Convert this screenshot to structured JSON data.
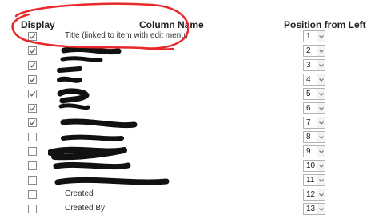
{
  "headers": {
    "display": "Display",
    "column_name": "Column Name",
    "position": "Position from Left"
  },
  "rows": [
    {
      "checked": true,
      "name": "Title (linked to item with edit menu)",
      "position": "1"
    },
    {
      "checked": true,
      "name": "",
      "position": "2"
    },
    {
      "checked": true,
      "name": "",
      "position": "3"
    },
    {
      "checked": true,
      "name": "",
      "position": "4"
    },
    {
      "checked": true,
      "name": "",
      "position": "5"
    },
    {
      "checked": true,
      "name": "",
      "position": "6"
    },
    {
      "checked": true,
      "name": "",
      "position": "7"
    },
    {
      "checked": false,
      "name": "",
      "position": "8"
    },
    {
      "checked": false,
      "name": "",
      "position": "9"
    },
    {
      "checked": false,
      "name": "",
      "position": "10"
    },
    {
      "checked": false,
      "name": "",
      "position": "11"
    },
    {
      "checked": false,
      "name": "Created",
      "position": "12"
    },
    {
      "checked": false,
      "name": "Created By",
      "position": "13"
    }
  ],
  "colors": {
    "annotation": "#e8292b",
    "redaction": "#111111",
    "checkmark": "#555555"
  }
}
